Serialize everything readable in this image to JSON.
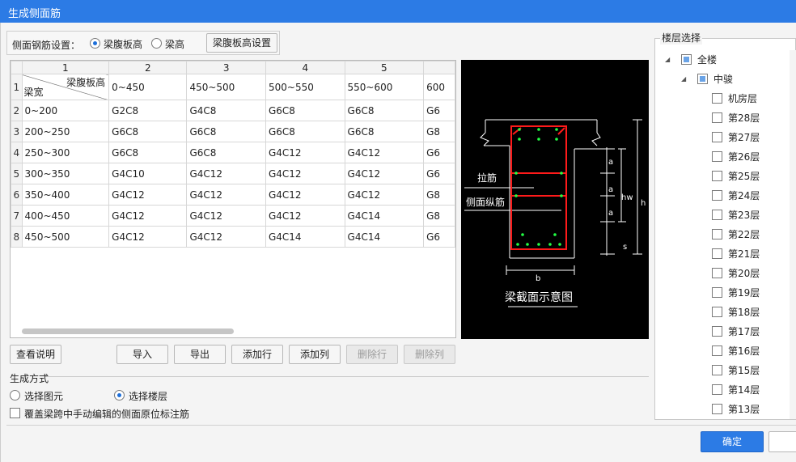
{
  "window": {
    "title": "生成侧面筋"
  },
  "settings": {
    "label": "侧面钢筋设置：",
    "opt_web_height": "梁腹板高",
    "opt_beam_height": "梁高",
    "selected": "梁腹板高",
    "web_height_settings_button": "梁腹板高设置"
  },
  "table": {
    "col_numbers": [
      "1",
      "2",
      "3",
      "4",
      "5"
    ],
    "corner_top": "梁腹板高",
    "corner_bottom": "梁宽",
    "headers": [
      "0~450",
      "450~500",
      "500~550",
      "550~600",
      "600"
    ],
    "rows": [
      {
        "n": "2",
        "width": "0~200",
        "cells": [
          "G2C8",
          "G4C8",
          "G6C8",
          "G6C8",
          "G6"
        ]
      },
      {
        "n": "3",
        "width": "200~250",
        "cells": [
          "G6C8",
          "G6C8",
          "G6C8",
          "G6C8",
          "G8"
        ]
      },
      {
        "n": "4",
        "width": "250~300",
        "cells": [
          "G6C8",
          "G6C8",
          "G4C12",
          "G4C12",
          "G6"
        ]
      },
      {
        "n": "5",
        "width": "300~350",
        "cells": [
          "G4C10",
          "G4C12",
          "G4C12",
          "G4C12",
          "G6"
        ]
      },
      {
        "n": "6",
        "width": "350~400",
        "cells": [
          "G4C12",
          "G4C12",
          "G4C12",
          "G4C12",
          "G8"
        ]
      },
      {
        "n": "7",
        "width": "400~450",
        "cells": [
          "G4C12",
          "G4C12",
          "G4C12",
          "G4C14",
          "G8"
        ]
      },
      {
        "n": "8",
        "width": "450~500",
        "cells": [
          "G4C12",
          "G4C12",
          "G4C14",
          "G4C14",
          "G6"
        ]
      }
    ]
  },
  "buttons": {
    "view_help": "查看说明",
    "import": "导入",
    "export": "导出",
    "add_row": "添加行",
    "add_col": "添加列",
    "delete_row": "删除行",
    "delete_col": "删除列",
    "ok": "确定"
  },
  "diagram": {
    "tie_bar": "拉筋",
    "side_bar": "侧面纵筋",
    "a": "a",
    "hw": "hw",
    "h": "h",
    "s": "s",
    "b": "b",
    "caption": "梁截面示意图"
  },
  "generation": {
    "title": "生成方式",
    "opt_select_element": "选择图元",
    "opt_select_floor": "选择楼层",
    "selected": "选择楼层",
    "override_label": "覆盖梁跨中手动编辑的侧面原位标注筋"
  },
  "floors": {
    "title": "楼层选择",
    "root": "全楼",
    "group": "中骏",
    "items": [
      "机房层",
      "第28层",
      "第27层",
      "第26层",
      "第25层",
      "第24层",
      "第23层",
      "第22层",
      "第21层",
      "第20层",
      "第19层",
      "第18层",
      "第17层",
      "第16层",
      "第15层",
      "第14层",
      "第13层"
    ]
  }
}
